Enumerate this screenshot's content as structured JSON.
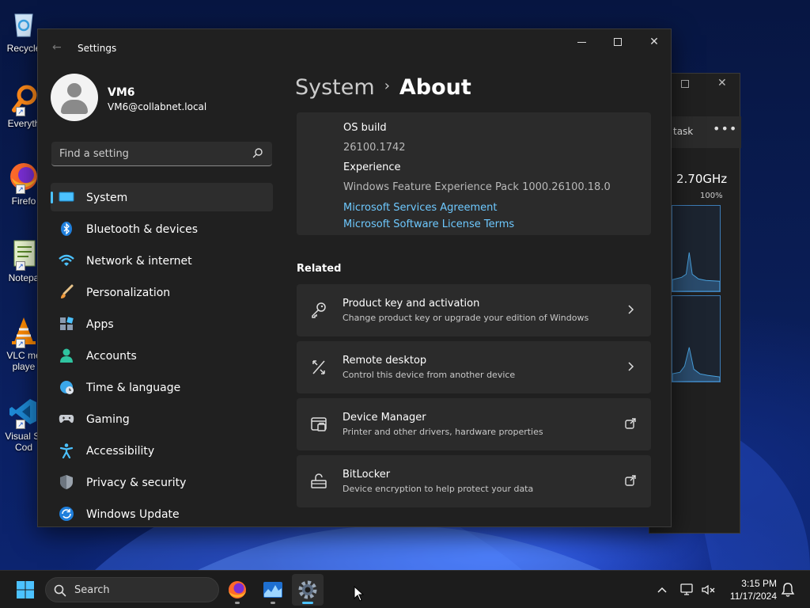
{
  "desktop": {
    "icons": [
      {
        "label": "Recycle"
      },
      {
        "label": "Everyth"
      },
      {
        "label": "Firefo"
      },
      {
        "label": "Notepa"
      },
      {
        "label": "VLC me\nplaye"
      },
      {
        "label": "Visual St\nCod"
      }
    ]
  },
  "taskmgr": {
    "task_label": "task",
    "speed": "2.70GHz",
    "percent": "100%"
  },
  "settings": {
    "window_title": "Settings",
    "user": {
      "name": "VM6",
      "email": "VM6@collabnet.local"
    },
    "search_placeholder": "Find a setting",
    "nav": [
      {
        "label": "System",
        "icon": "system-icon",
        "active": true
      },
      {
        "label": "Bluetooth & devices",
        "icon": "bluetooth-icon"
      },
      {
        "label": "Network & internet",
        "icon": "network-icon"
      },
      {
        "label": "Personalization",
        "icon": "brush-icon"
      },
      {
        "label": "Apps",
        "icon": "apps-icon"
      },
      {
        "label": "Accounts",
        "icon": "accounts-icon"
      },
      {
        "label": "Time & language",
        "icon": "time-language-icon"
      },
      {
        "label": "Gaming",
        "icon": "gaming-icon"
      },
      {
        "label": "Accessibility",
        "icon": "accessibility-icon"
      },
      {
        "label": "Privacy & security",
        "icon": "shield-icon"
      },
      {
        "label": "Windows Update",
        "icon": "update-icon"
      }
    ],
    "breadcrumb": {
      "parent": "System",
      "separator": "›",
      "current": "About"
    },
    "specs": {
      "os_build_label": "OS build",
      "os_build_value": "26100.1742",
      "experience_label": "Experience",
      "experience_value": "Windows Feature Experience Pack 1000.26100.18.0",
      "link_services": "Microsoft Services Agreement",
      "link_license": "Microsoft Software License Terms"
    },
    "related_heading": "Related",
    "related": [
      {
        "title": "Product key and activation",
        "subtitle": "Change product key or upgrade your edition of Windows",
        "icon": "key-icon",
        "action": "chevron-right-icon"
      },
      {
        "title": "Remote desktop",
        "subtitle": "Control this device from another device",
        "icon": "remote-desktop-icon",
        "action": "chevron-right-icon"
      },
      {
        "title": "Device Manager",
        "subtitle": "Printer and other drivers, hardware properties",
        "icon": "device-manager-icon",
        "action": "external-link-icon"
      },
      {
        "title": "BitLocker",
        "subtitle": "Device encryption to help protect your data",
        "icon": "bitlocker-icon",
        "action": "external-link-icon"
      }
    ]
  },
  "taskbar": {
    "search_label": "Search",
    "time": "3:15 PM",
    "date": "11/17/2024"
  },
  "colors": {
    "accent": "#4cc2ff",
    "link": "#6ec9ff",
    "window_bg": "#202020",
    "card_bg": "#2b2b2b"
  }
}
